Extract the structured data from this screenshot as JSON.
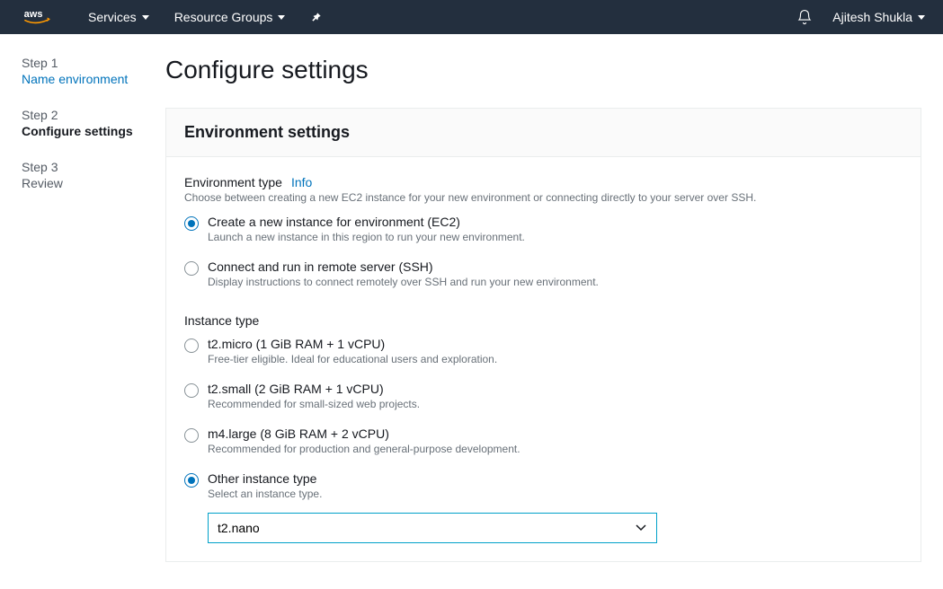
{
  "nav": {
    "services": "Services",
    "resource_groups": "Resource Groups",
    "user": "Ajitesh Shukla"
  },
  "sidebar": {
    "steps": [
      {
        "label": "Step 1",
        "title": "Name environment",
        "state": "link"
      },
      {
        "label": "Step 2",
        "title": "Configure settings",
        "state": "current"
      },
      {
        "label": "Step 3",
        "title": "Review",
        "state": "muted"
      }
    ]
  },
  "page": {
    "title": "Configure settings",
    "panel_header": "Environment settings"
  },
  "env_type": {
    "label": "Environment type",
    "info": "Info",
    "help": "Choose between creating a new EC2 instance for your new environment or connecting directly to your server over SSH.",
    "options": [
      {
        "title": "Create a new instance for environment (EC2)",
        "desc": "Launch a new instance in this region to run your new environment.",
        "checked": true
      },
      {
        "title": "Connect and run in remote server (SSH)",
        "desc": "Display instructions to connect remotely over SSH and run your new environment.",
        "checked": false
      }
    ]
  },
  "inst_type": {
    "label": "Instance type",
    "options": [
      {
        "title": "t2.micro (1 GiB RAM + 1 vCPU)",
        "desc": "Free-tier eligible. Ideal for educational users and exploration.",
        "checked": false
      },
      {
        "title": "t2.small (2 GiB RAM + 1 vCPU)",
        "desc": "Recommended for small-sized web projects.",
        "checked": false
      },
      {
        "title": "m4.large (8 GiB RAM + 2 vCPU)",
        "desc": "Recommended for production and general-purpose development.",
        "checked": false
      },
      {
        "title": "Other instance type",
        "desc": "Select an instance type.",
        "checked": true
      }
    ],
    "select_value": "t2.nano"
  }
}
